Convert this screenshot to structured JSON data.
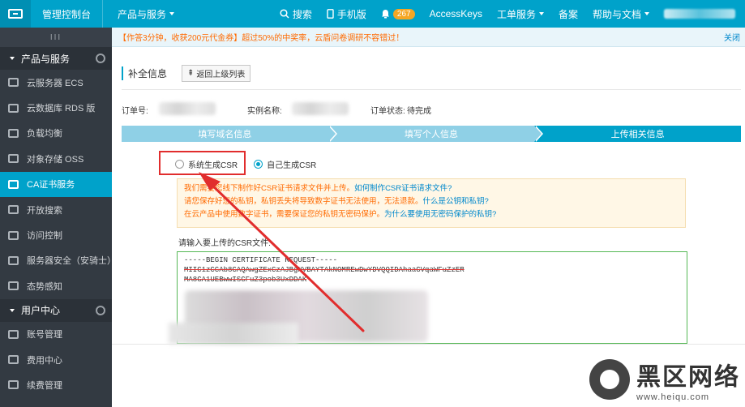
{
  "topbar": {
    "title": "管理控制台",
    "products": "产品与服务",
    "search": "搜索",
    "mobile": "手机版",
    "notif_count": "267",
    "accesskeys": "AccessKeys",
    "ticket": "工单服务",
    "record": "备案",
    "help": "帮助与文档"
  },
  "notice": {
    "text": "【作答3分钟，收获200元代金券】超过50%的中奖率，云盾问卷调研不容错过！",
    "close": "关闭"
  },
  "sidebar": {
    "handle": "III",
    "group1": "产品与服务",
    "items": [
      {
        "label": "云服务器 ECS",
        "icon": "server-icon"
      },
      {
        "label": "云数据库 RDS 版",
        "icon": "database-icon"
      },
      {
        "label": "负载均衡",
        "icon": "load-balancer-icon"
      },
      {
        "label": "对象存储 OSS",
        "icon": "storage-icon"
      },
      {
        "label": "CA证书服务",
        "icon": "certificate-icon"
      },
      {
        "label": "开放搜索",
        "icon": "search-service-icon"
      },
      {
        "label": "访问控制",
        "icon": "access-control-icon"
      },
      {
        "label": "服务器安全（安骑士）",
        "icon": "shield-icon"
      },
      {
        "label": "态势感知",
        "icon": "awareness-icon"
      }
    ],
    "group2": "用户中心",
    "items2": [
      {
        "label": "账号管理",
        "icon": "user-icon"
      },
      {
        "label": "费用中心",
        "icon": "yen-icon"
      },
      {
        "label": "续费管理",
        "icon": "renew-icon"
      }
    ]
  },
  "page": {
    "title": "补全信息",
    "back": "返回上级列表",
    "order_no_label": "订单号:",
    "instance_label": "实例名称:",
    "status_label": "订单状态:",
    "status_value": "待完成"
  },
  "steps": [
    "填写域名信息",
    "填写个人信息",
    "上传相关信息"
  ],
  "csr_options": {
    "system": "系统生成CSR",
    "self": "自己生成CSR"
  },
  "warning": {
    "line1": "我们需要您线下制作好CSR证书请求文件并上传。",
    "line1_link": "如何制作CSR证书请求文件?",
    "line2": "请您保存好您的私钥，私钥丢失将导致数字证书无法使用，无法退款。",
    "line2_link": "什么是公钥和私钥?",
    "line3": "在云产品中使用数字证书，需要保证您的私钥无密码保护。",
    "line3_link": "为什么要使用无密码保护的私钥?"
  },
  "csr": {
    "label": "请输入要上传的CSR文件:",
    "lines": [
      "-----BEGIN CERTIFICATE REQUEST-----",
      "MIIC1zCCAb8CAQAwgZExCzAJBgNVBAYTAkNOMREwDwYDVQQIDAhaaGVqaWFuZzER",
      "MA8GA1UEBwwISGFuZ3pob3UxDDAK",
      "",
      "",
      "",
      "",
      "",
      "                          1lbc0ZDGAkbHzLaa1Gah"
    ]
  },
  "watermark": {
    "cn": "黑区网络",
    "url": "www.heiqu.com"
  }
}
